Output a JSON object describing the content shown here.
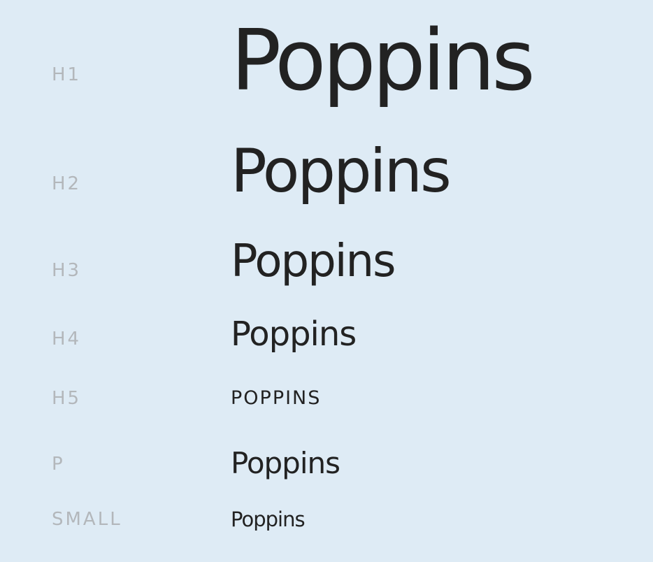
{
  "rows": [
    {
      "label": "H1",
      "sample": "Poppins"
    },
    {
      "label": "H2",
      "sample": "Poppins"
    },
    {
      "label": "H3",
      "sample": "Poppins"
    },
    {
      "label": "H4",
      "sample": "Poppins"
    },
    {
      "label": "H5",
      "sample": "POPPINS"
    },
    {
      "label": "P",
      "sample": "Poppins"
    },
    {
      "label": "SMALL",
      "sample": "Poppins"
    }
  ],
  "colors": {
    "background": "#deebf5",
    "label": "#b3b7bb",
    "sample": "#222222"
  }
}
